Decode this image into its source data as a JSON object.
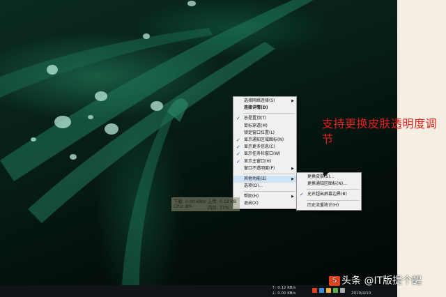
{
  "main_menu": {
    "items": [
      {
        "label": "选择网络连接(S)",
        "checked": false,
        "submenu": true
      },
      {
        "label": "连接详情(D)",
        "checked": false,
        "submenu": false,
        "bold": true
      },
      {
        "separator": true
      },
      {
        "label": "总是置顶(T)",
        "checked": true,
        "submenu": false
      },
      {
        "label": "鼠标穿透(M)",
        "checked": false,
        "submenu": false
      },
      {
        "label": "锁定窗口位置(L)",
        "checked": false,
        "submenu": false
      },
      {
        "label": "显示通知区域图标(N)",
        "checked": true,
        "submenu": false
      },
      {
        "label": "显示更多信息(C)",
        "checked": true,
        "submenu": false
      },
      {
        "label": "显示任务栏窗口(W)",
        "checked": true,
        "submenu": false
      },
      {
        "label": "显示主窗口(H)",
        "checked": true,
        "submenu": false
      },
      {
        "label": "窗口不透明度(P)",
        "checked": false,
        "submenu": true
      },
      {
        "separator": true
      },
      {
        "label": "其他功能(E)",
        "checked": false,
        "submenu": true,
        "highlighted": true
      },
      {
        "label": "选项(O)...",
        "checked": false,
        "submenu": false
      },
      {
        "separator": true
      },
      {
        "label": "帮助(H)",
        "checked": false,
        "submenu": true
      },
      {
        "label": "退出(X)",
        "checked": false,
        "submenu": false
      }
    ]
  },
  "sub_menu": {
    "items": [
      {
        "label": "更换皮肤(S)...",
        "checked": false
      },
      {
        "label": "更换通知区图标(N)...",
        "checked": false
      },
      {
        "separator": true
      },
      {
        "label": "允许超出屏幕边界(B)",
        "checked": true
      },
      {
        "separator": true
      },
      {
        "label": "历史流量统计(H)",
        "checked": false
      }
    ]
  },
  "annotation": {
    "text": "支持更换皮肤透明度调节",
    "color": "#e2211c"
  },
  "net_widget": {
    "download": "下载: 0.00 KB/s",
    "upload": "上传: 0.12 KB",
    "cpu": "CPU: 8%",
    "memory": "内存: 37%"
  },
  "taskbar": {
    "upload": "↑: 0.12 KB/s",
    "download": "↓: 0.00 KB/s",
    "date": "2019/4/10",
    "tray_icon_colors": [
      "#e2411c",
      "#3a8fd9",
      "#f0b43c",
      "#5fb04a",
      "#aaaaaa"
    ]
  },
  "watermark": {
    "logo": "S",
    "text": "头条 @IT版提个醒"
  }
}
